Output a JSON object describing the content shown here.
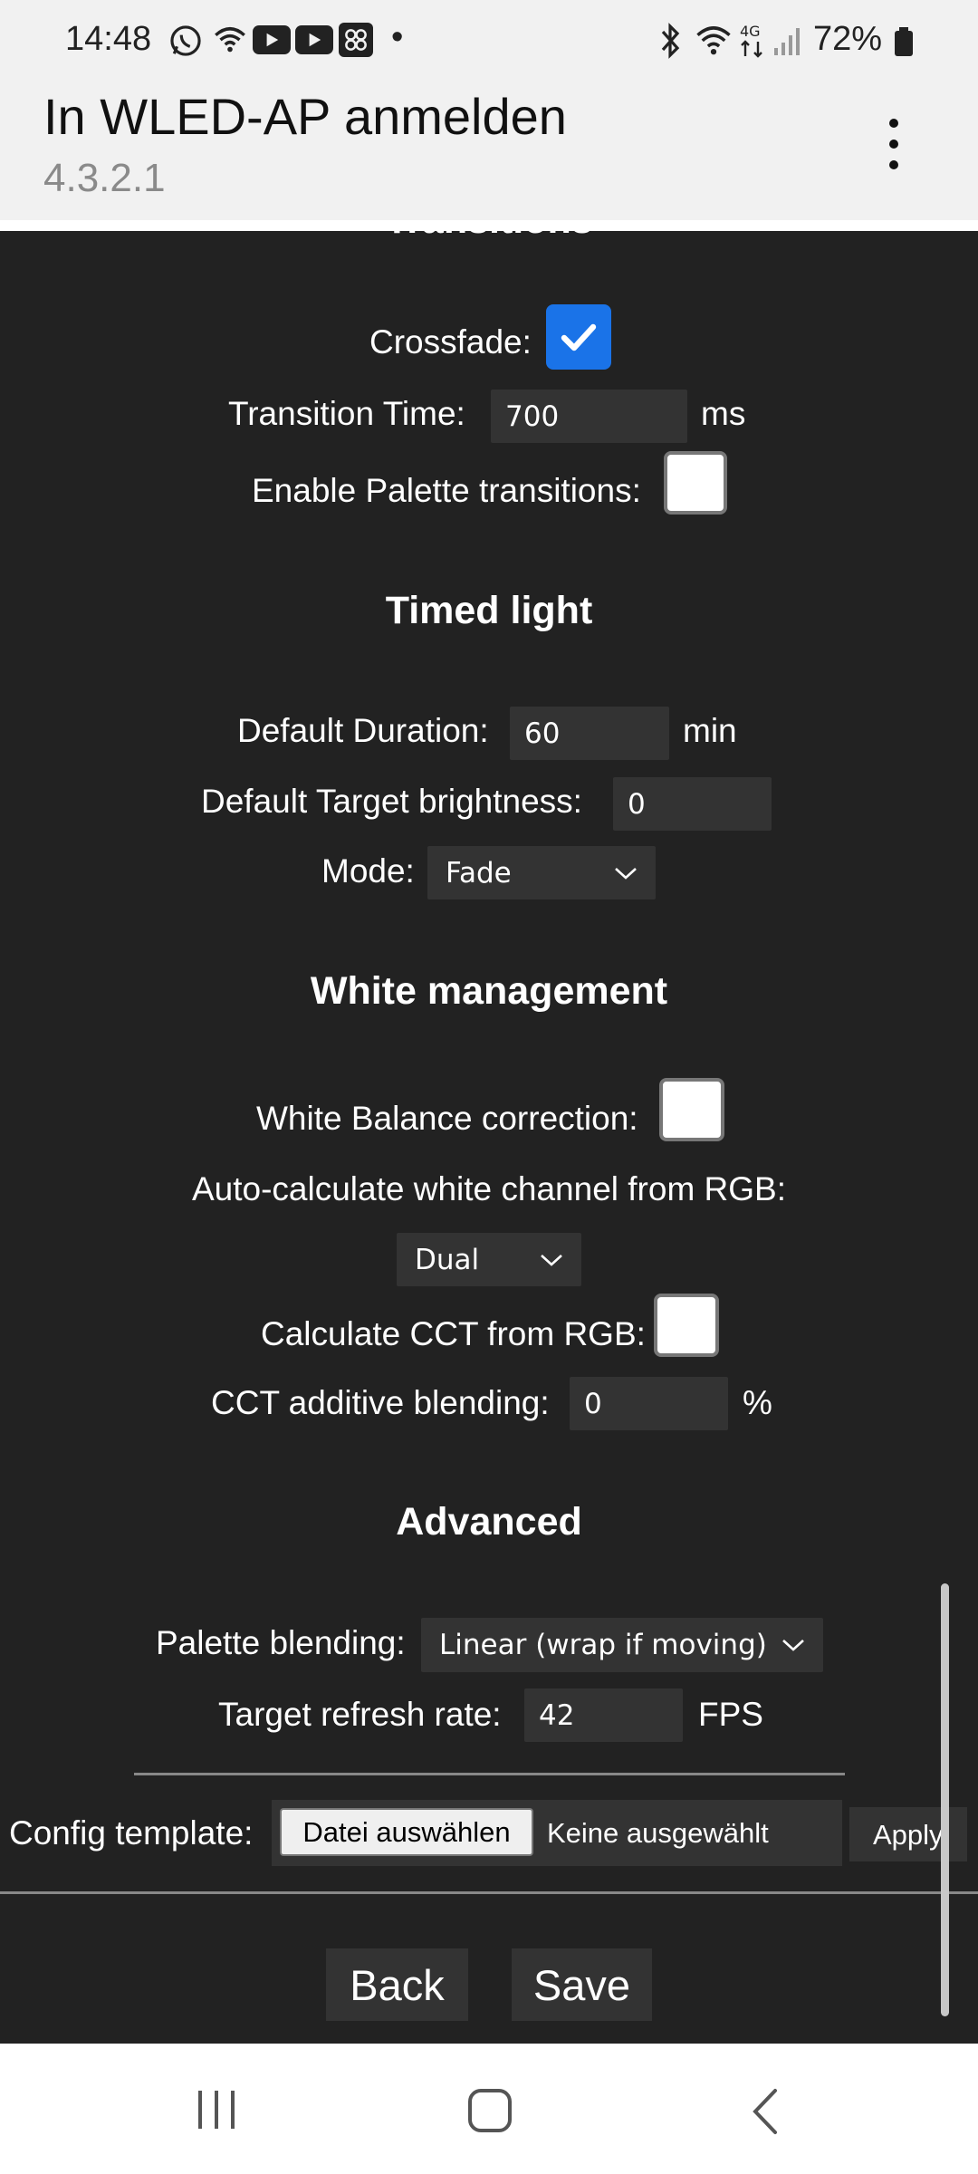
{
  "status_bar": {
    "time": "14:48",
    "dot": "•",
    "battery": "72%",
    "icons": [
      "whatsapp-icon",
      "wifi-call-icon",
      "youtube-icon",
      "youtube-icon",
      "app-grid-icon",
      "bluetooth-icon",
      "wifi-icon",
      "4g-icon",
      "signal-icon",
      "battery-icon"
    ]
  },
  "header": {
    "title": "In WLED-AP anmelden",
    "subtitle": "4.3.2.1",
    "menu_icon": "more-vert-icon"
  },
  "transitions": {
    "heading_partial": "Transitions",
    "crossfade_label": "Crossfade:",
    "crossfade_checked": true,
    "transition_time_label": "Transition Time:",
    "transition_time_value": "700",
    "transition_time_unit": "ms",
    "palette_transitions_label": "Enable Palette transitions:",
    "palette_transitions_checked": false
  },
  "timed_light": {
    "heading": "Timed light",
    "default_duration_label": "Default Duration:",
    "default_duration_value": "60",
    "default_duration_unit": "min",
    "target_brightness_label": "Default Target brightness:",
    "target_brightness_value": "0",
    "mode_label": "Mode:",
    "mode_value": "Fade"
  },
  "white_management": {
    "heading": "White management",
    "wb_correction_label": "White Balance correction:",
    "wb_correction_checked": false,
    "auto_white_label": "Auto-calculate white channel from RGB:",
    "auto_white_value": "Dual",
    "calc_cct_label": "Calculate CCT from RGB:",
    "calc_cct_checked": false,
    "cct_blending_label": "CCT additive blending:",
    "cct_blending_value": "0",
    "cct_blending_unit": "%"
  },
  "advanced": {
    "heading": "Advanced",
    "palette_blending_label": "Palette blending:",
    "palette_blending_value": "Linear (wrap if moving)",
    "refresh_rate_label": "Target refresh rate:",
    "refresh_rate_value": "42",
    "refresh_rate_unit": "FPS"
  },
  "config_template": {
    "label": "Config template:",
    "choose_file_label": "Datei auswählen",
    "no_file_text": "Keine ausgewählt",
    "apply_label": "Apply"
  },
  "actions": {
    "back_label": "Back",
    "save_label": "Save"
  },
  "nav_bar": {
    "icons": [
      "recent-apps-icon",
      "home-icon",
      "back-icon"
    ]
  }
}
